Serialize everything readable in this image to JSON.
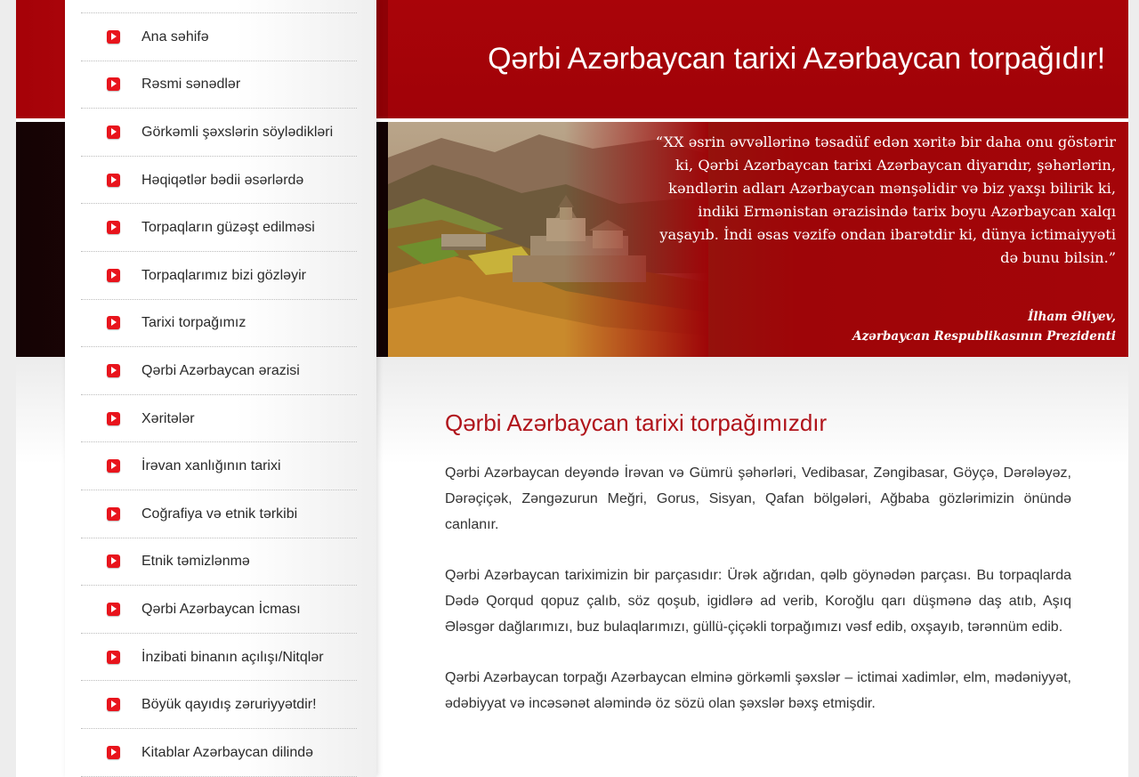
{
  "sidebar": {
    "items": [
      {
        "label": "Ana səhifə"
      },
      {
        "label": "Rəsmi sənədlər"
      },
      {
        "label": "Görkəmli şəxslərin söylədikləri"
      },
      {
        "label": "Həqiqətlər bədii əsərlərdə"
      },
      {
        "label": "Torpaqların güzəşt edilməsi"
      },
      {
        "label": "Torpaqlarımız bizi gözləyir"
      },
      {
        "label": "Tarixi torpağımız"
      },
      {
        "label": "Qərbi Azərbaycan ərazisi"
      },
      {
        "label": "Xəritələr"
      },
      {
        "label": "İrəvan xanlığının tarixi"
      },
      {
        "label": "Coğrafiya və etnik tərkibi"
      },
      {
        "label": "Etnik təmizlənmə"
      },
      {
        "label": "Qərbi Azərbaycan İcması"
      },
      {
        "label": "İnzibati binanın açılışı/Nitqlər"
      },
      {
        "label": "Böyük qayıdış zəruriyyətdir!"
      },
      {
        "label": "Kitablar Azərbaycan dilində"
      }
    ]
  },
  "header": {
    "title": "Qərbi Azərbaycan tarixi Azərbaycan torpağıdır!"
  },
  "hero": {
    "quote": "“XX əsrin əvvəllərinə təsadüf edən xəritə bir daha onu göstərir ki, Qərbi Azərbaycan tarixi Azərbaycan diyarıdır, şəhərlərin, kəndlərin adları Azərbaycan mənşəlidir və biz yaxşı bilirik ki, indiki Ermənistan ərazisində tarix boyu Azərbaycan xalqı yaşayıb. İndi əsas vəzifə ondan ibarətdir ki, dünya ictimaiyyəti də bunu bilsin.”",
    "author_name": "İlham Əliyev,",
    "author_title": "Azərbaycan Respublikasının Prezidenti"
  },
  "main": {
    "heading": "Qərbi Azərbaycan tarixi torpağımızdır",
    "paragraphs": [
      "Qərbi Azərbaycan deyəndə İrəvan və Gümrü şəhərləri, Vedibasar, Zəngibasar, Göyçə, Dərələyəz, Dərəçiçək, Zəngəzurun Meğri, Gorus, Sisyan, Qafan bölgələri, Ağbaba gözlərimizin önündə canlanır.",
      "Qərbi Azərbaycan tariximizin bir parçasıdır: Ürək ağrıdan, qəlb göynədən parçası. Bu torpaqlarda Dədə Qorqud qopuz çalıb, söz qoşub, igidlərə ad verib, Koroğlu qarı düşmənə daş atıb, Aşıq Ələsgər dağlarımızı, buz bulaqlarımızı, güllü-çiçəkli torpağımızı vəsf edib, oxşayıb, tərənnüm edib.",
      "Qərbi Azərbaycan torpağı Azərbaycan elminə görkəmli şəxslər – ictimai xadimlər, elm, mədəniyyət, ədəbiyyat və incəsənət aləmində öz sözü olan şəxslər bəxş etmişdir."
    ]
  },
  "colors": {
    "brand_red": "#a50208",
    "heading_red": "#b0141b",
    "icon_red": "#e8141c"
  }
}
